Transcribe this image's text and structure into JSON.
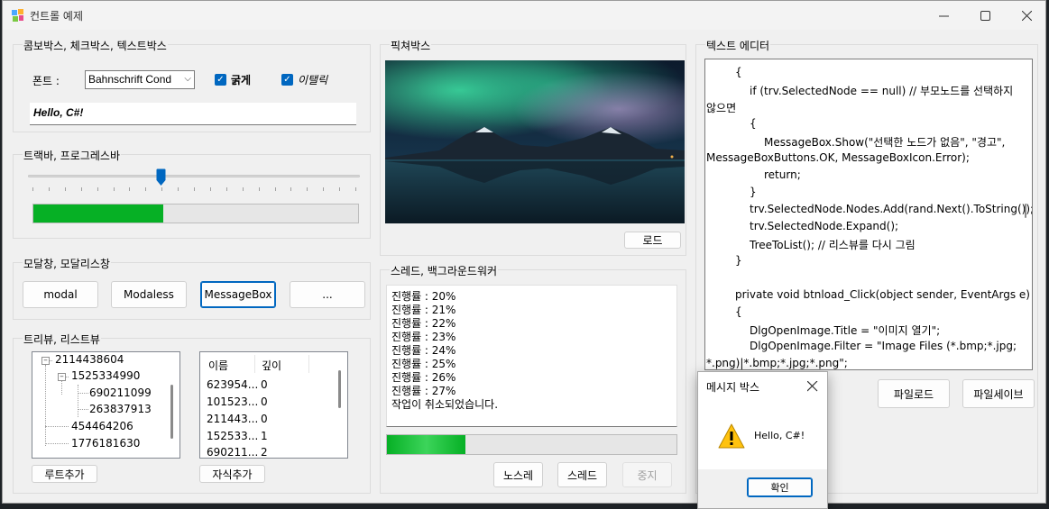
{
  "window": {
    "title": "컨트롤 예제"
  },
  "group1": {
    "label": "콤보박스, 체크박스, 텍스트박스",
    "font_label": "폰트 :",
    "combo_value": "Bahnschrift Cond",
    "bold_label": "굵게",
    "italic_label": "이탤릭",
    "text_value": "Hello, C#!"
  },
  "group2": {
    "label": "트랙바, 프로그레스바",
    "trackbar_value": 0.4,
    "progress_value": 0.4
  },
  "group3": {
    "label": "모달창, 모달리스창",
    "buttons": [
      "modal",
      "Modaless",
      "MessageBox",
      "..."
    ]
  },
  "group4": {
    "label": "트리뷰, 리스트뷰",
    "tree": [
      "2114438604",
      "1525334990",
      "690211099",
      "263837913",
      "454464206",
      "1776181630"
    ],
    "list_headers": [
      "이름",
      "깊이"
    ],
    "list_rows": [
      [
        "623954...",
        "0"
      ],
      [
        "101523...",
        "0"
      ],
      [
        "211443...",
        "0"
      ],
      [
        "152533...",
        "1"
      ],
      [
        "690211...",
        "2"
      ]
    ],
    "add_root_label": "루트추가",
    "add_child_label": "자식추가"
  },
  "picture": {
    "label": "픽쳐박스",
    "load_label": "로드"
  },
  "thread": {
    "label": "스레드, 백그라운드워커",
    "log": [
      "진행률 : 20%",
      "진행률 : 21%",
      "진행률 : 22%",
      "진행률 : 23%",
      "진행률 : 24%",
      "진행률 : 25%",
      "진행률 : 26%",
      "진행률 : 27%",
      "작업이 취소되었습니다."
    ],
    "progress_value": 0.27,
    "noslay_label": "노스레",
    "thread_label": "스레드",
    "stop_label": "중지"
  },
  "editor": {
    "label": "텍스트 에디터",
    "lines": [
      "{",
      "if (trv.SelectedNode == null) // 부모노드를 선택하지",
      "않으면",
      "{",
      "MessageBox.Show(\"선택한 노드가 없음\", \"경고\",",
      "MessageBoxButtons.OK, MessageBoxIcon.Error);",
      "return;",
      "}",
      "trv.SelectedNode.Nodes.Add(rand.Next().ToString());",
      "trv.SelectedNode.Expand();",
      "TreeToList(); // 리스뷰를 다시 그림",
      "}",
      "",
      "private void btnload_Click(object sender, EventArgs e)",
      "{",
      "DlgOpenImage.Title = \"이미지 열기\";",
      "DlgOpenImage.Filter = \"Image Files (*.bmp;*.jpg;",
      "*.png)|*.bmp;*.jpg;*.png\";"
    ],
    "file_load_label": "파일로드",
    "file_save_label": "파일세이브"
  },
  "messagebox": {
    "title": "메시지 박스",
    "message": "Hello, C#!",
    "ok_label": "확인"
  }
}
